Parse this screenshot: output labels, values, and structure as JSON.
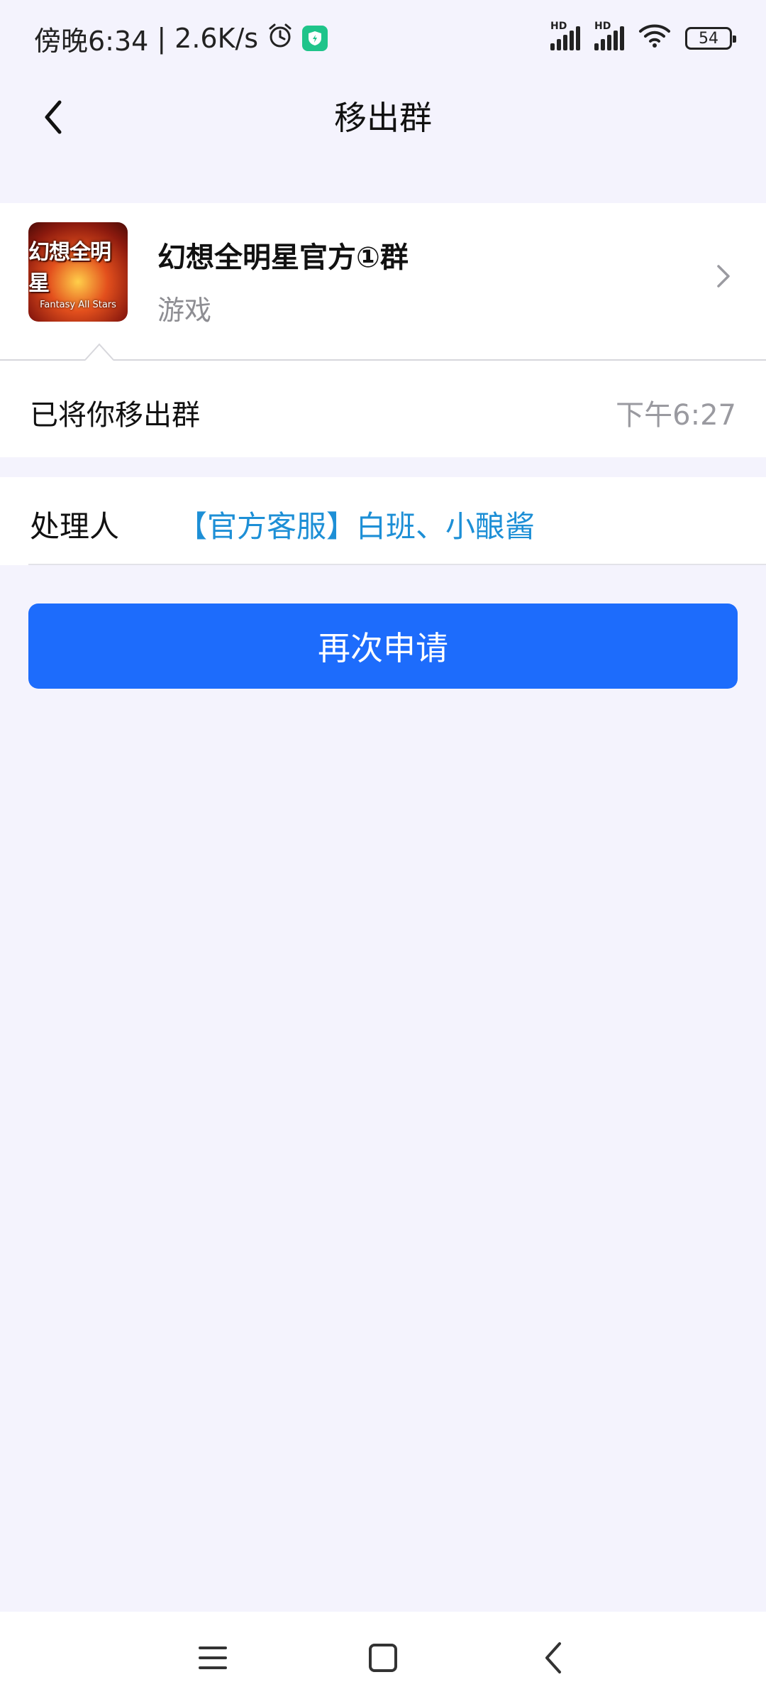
{
  "status_bar": {
    "time": "傍晚6:34",
    "network_speed": "2.6K/s",
    "battery": "54",
    "icons": [
      "alarm-icon",
      "shield-app-icon",
      "hd-signal-icon",
      "hd-signal-icon",
      "wifi-icon",
      "battery-icon"
    ]
  },
  "navbar": {
    "title": "移出群",
    "back_icon": "back-chevron-icon"
  },
  "group": {
    "name": "幻想全明星官方①群",
    "category": "游戏",
    "avatar_text": "幻想全明星",
    "avatar_subtext": "Fantasy All Stars"
  },
  "notice": {
    "message": "已将你移出群",
    "time": "下午6:27"
  },
  "handler": {
    "label": "处理人",
    "value": "【官方客服】白班、小酿酱"
  },
  "actions": {
    "reapply_label": "再次申请"
  },
  "system_nav": {
    "icons": [
      "menu-icon",
      "home-icon",
      "back-icon"
    ]
  },
  "colors": {
    "background": "#f4f3fd",
    "primary_button": "#1d6cfc",
    "link": "#1d8fd6",
    "secondary_text": "#8e8e93"
  }
}
